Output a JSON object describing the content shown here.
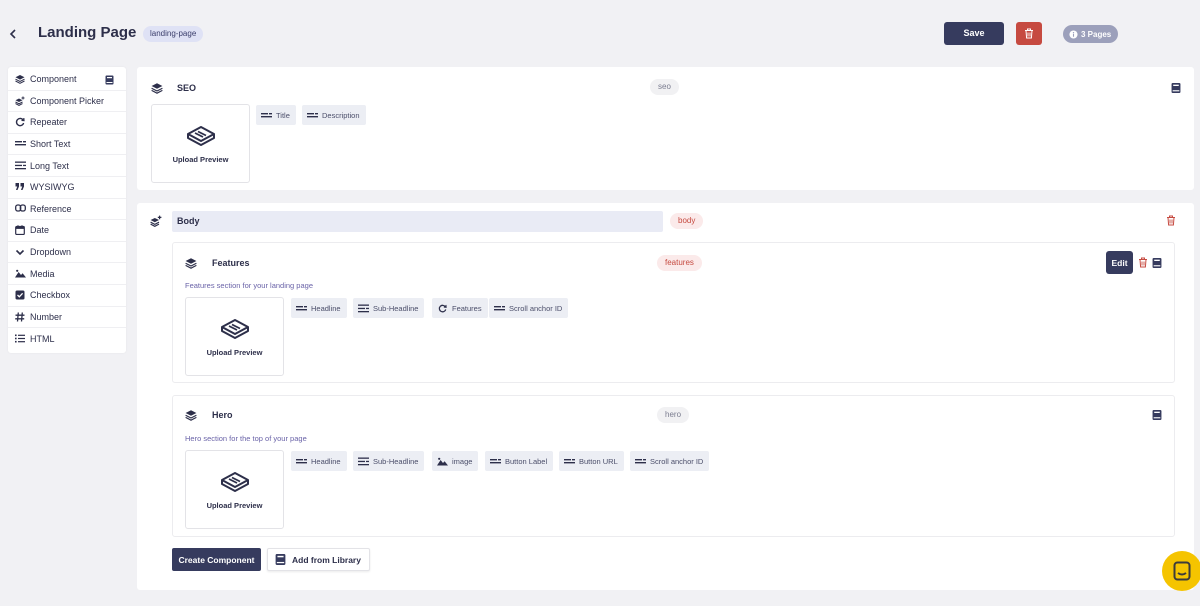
{
  "header": {
    "title": "Landing Page",
    "slug": "landing-page",
    "save_label": "Save",
    "pages_label": "3 Pages"
  },
  "sidebar": {
    "items": [
      {
        "label": "Component",
        "icon": "layers-icon"
      },
      {
        "label": "Component Picker",
        "icon": "layers-plus-icon"
      },
      {
        "label": "Repeater",
        "icon": "repeat-icon"
      },
      {
        "label": "Short Text",
        "icon": "short-text-icon"
      },
      {
        "label": "Long Text",
        "icon": "long-text-icon"
      },
      {
        "label": "WYSIWYG",
        "icon": "quote-icon"
      },
      {
        "label": "Reference",
        "icon": "link-icon"
      },
      {
        "label": "Date",
        "icon": "calendar-icon"
      },
      {
        "label": "Dropdown",
        "icon": "chevron-down-icon"
      },
      {
        "label": "Media",
        "icon": "image-icon"
      },
      {
        "label": "Checkbox",
        "icon": "checkbox-icon"
      },
      {
        "label": "Number",
        "icon": "hash-icon"
      },
      {
        "label": "HTML",
        "icon": "list-icon"
      }
    ]
  },
  "seo": {
    "title": "SEO",
    "tag": "seo",
    "preview_label": "Upload Preview",
    "fields": [
      "Title",
      "Description"
    ]
  },
  "body": {
    "title": "Body",
    "tag": "body",
    "features": {
      "title": "Features",
      "tag": "features",
      "description": "Features section for your landing page",
      "preview_label": "Upload Preview",
      "edit_label": "Edit",
      "fields": [
        "Headline",
        "Sub-Headline",
        "Features",
        "Scroll anchor ID"
      ]
    },
    "hero": {
      "title": "Hero",
      "tag": "hero",
      "description": "Hero section for the top of your page",
      "preview_label": "Upload Preview",
      "fields": [
        "Headline",
        "Sub-Headline",
        "image",
        "Button Label",
        "Button URL",
        "Scroll anchor ID"
      ]
    },
    "create_label": "Create Component",
    "library_label": "Add from Library"
  },
  "colors": {
    "primary": "#363b5e",
    "danger": "#c64a40",
    "accent_chat": "#f5c400"
  }
}
